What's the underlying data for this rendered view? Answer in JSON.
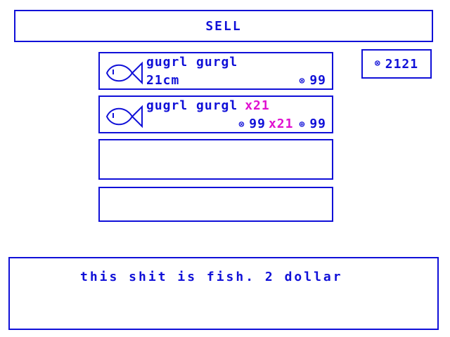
{
  "title": "SELL",
  "wallet": {
    "coin_icon": "coin-icon",
    "amount": "2121"
  },
  "slots": [
    {
      "icon": "fish-icon",
      "name": "gugrl gurgl",
      "size": "21cm",
      "price": "99"
    },
    {
      "icon": "fish-icon",
      "name": "gugrl gurgl",
      "quantity": "x21",
      "unit_price": "99",
      "multiplier": "x21",
      "total_price": "99"
    },
    {},
    {}
  ],
  "dialog": {
    "text": "this shit is fish. 2 dollar"
  },
  "colors": {
    "primary": "#1010d8",
    "accent": "#e010d0",
    "background": "#ffffff"
  }
}
